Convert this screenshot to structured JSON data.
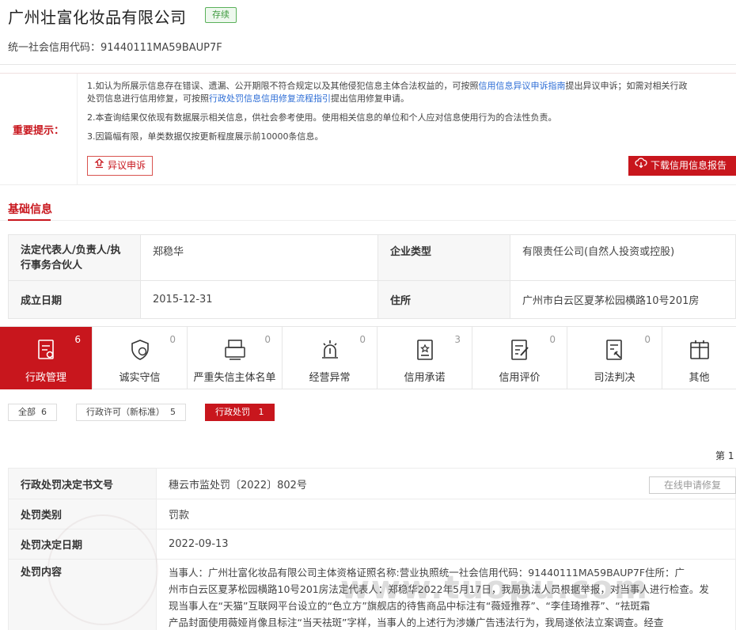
{
  "header": {
    "company_name": "广州壮富化妆品有限公司",
    "status": "存续",
    "credit_code": "统一社会信用代码：91440111MA59BAUP7F"
  },
  "notice": {
    "label": "重要提示：",
    "line1_a": "1.如认为所展示信息存在错误、遗漏、公开期限不符合规定以及其他侵犯信息主体合法权益的，可按照",
    "line1_link1": "信用信息异议申诉指南",
    "line1_b": "提出异议申诉；如需对相关行政",
    "line1_c": "处罚信息进行信用修复，可按照",
    "line1_link2": "行政处罚信息信用修复流程指引",
    "line1_d": "提出信用修复申请。",
    "line2": "2.本查询结果仅依现有数据展示相关信息，供社会参考使用。使用相关信息的单位和个人应对信息使用行为的合法性负责。",
    "line3": "3.因篇幅有限，单类数据仅按更新程度展示前10000条信息。",
    "appeal_button": "异议申诉",
    "download_button": "下载信用信息报告"
  },
  "basic_info": {
    "section_title": "基础信息",
    "legal_rep_label": "法定代表人/负责人/执行事务合伙人",
    "legal_rep_value": "郑稳华",
    "type_label": "企业类型",
    "type_value": "有限责任公司(自然人投资或控股)",
    "founded_label": "成立日期",
    "founded_value": "2015-12-31",
    "address_label": "住所",
    "address_value": "广州市白云区夏茅松园横路10号201房"
  },
  "tabs": [
    {
      "label": "行政管理",
      "count": "6",
      "icon": "admin-management-icon"
    },
    {
      "label": "诚实守信",
      "count": "0",
      "icon": "shield-trust-icon"
    },
    {
      "label": "严重失信主体名单",
      "count": "0",
      "icon": "dishonest-list-icon"
    },
    {
      "label": "经营异常",
      "count": "0",
      "icon": "alarm-light-icon"
    },
    {
      "label": "信用承诺",
      "count": "3",
      "icon": "commitment-icon"
    },
    {
      "label": "信用评价",
      "count": "0",
      "icon": "evaluation-icon"
    },
    {
      "label": "司法判决",
      "count": "0",
      "icon": "judgment-icon"
    },
    {
      "label": "其他",
      "count": "",
      "icon": "other-icon"
    }
  ],
  "filters": [
    {
      "label": "全部",
      "count": "6"
    },
    {
      "label": "行政许可（新标准）",
      "count": "5"
    },
    {
      "label": "行政处罚",
      "count": "1"
    }
  ],
  "page": "第 1",
  "detail": {
    "decision_no_label": "行政处罚决定书文号",
    "decision_no_value": "穗云市监处罚〔2022〕802号",
    "repair_button": "在线申请修复",
    "category_label": "处罚类别",
    "category_value": "罚款",
    "date_label": "处罚决定日期",
    "date_value": "2022-09-13",
    "content_label": "处罚内容",
    "content_line1": "当事人：广州壮富化妆品有限公司主体资格证照名称:营业执照统一社会信用代码：91440111MA59BAUP7F住所：广",
    "content_line2": "州市白云区夏茅松园横路10号201房法定代表人：郑稳华2022年5月17日，我局执法人员根据举报，对当事人进行检查。发",
    "content_line3": "现当事人在“天猫”互联网平台设立的“色立方”旗舰店的待售商品中标注有“薇娅推荐”、“李佳琦推荐”、“祛斑霜",
    "content_line4": "产品封面使用薇娅肖像且标注“当天祛斑”字样，当事人的上述行为涉嫌广告违法行为，我局遂依法立案调查。经查"
  },
  "watermark": "www.tuopu.com"
}
